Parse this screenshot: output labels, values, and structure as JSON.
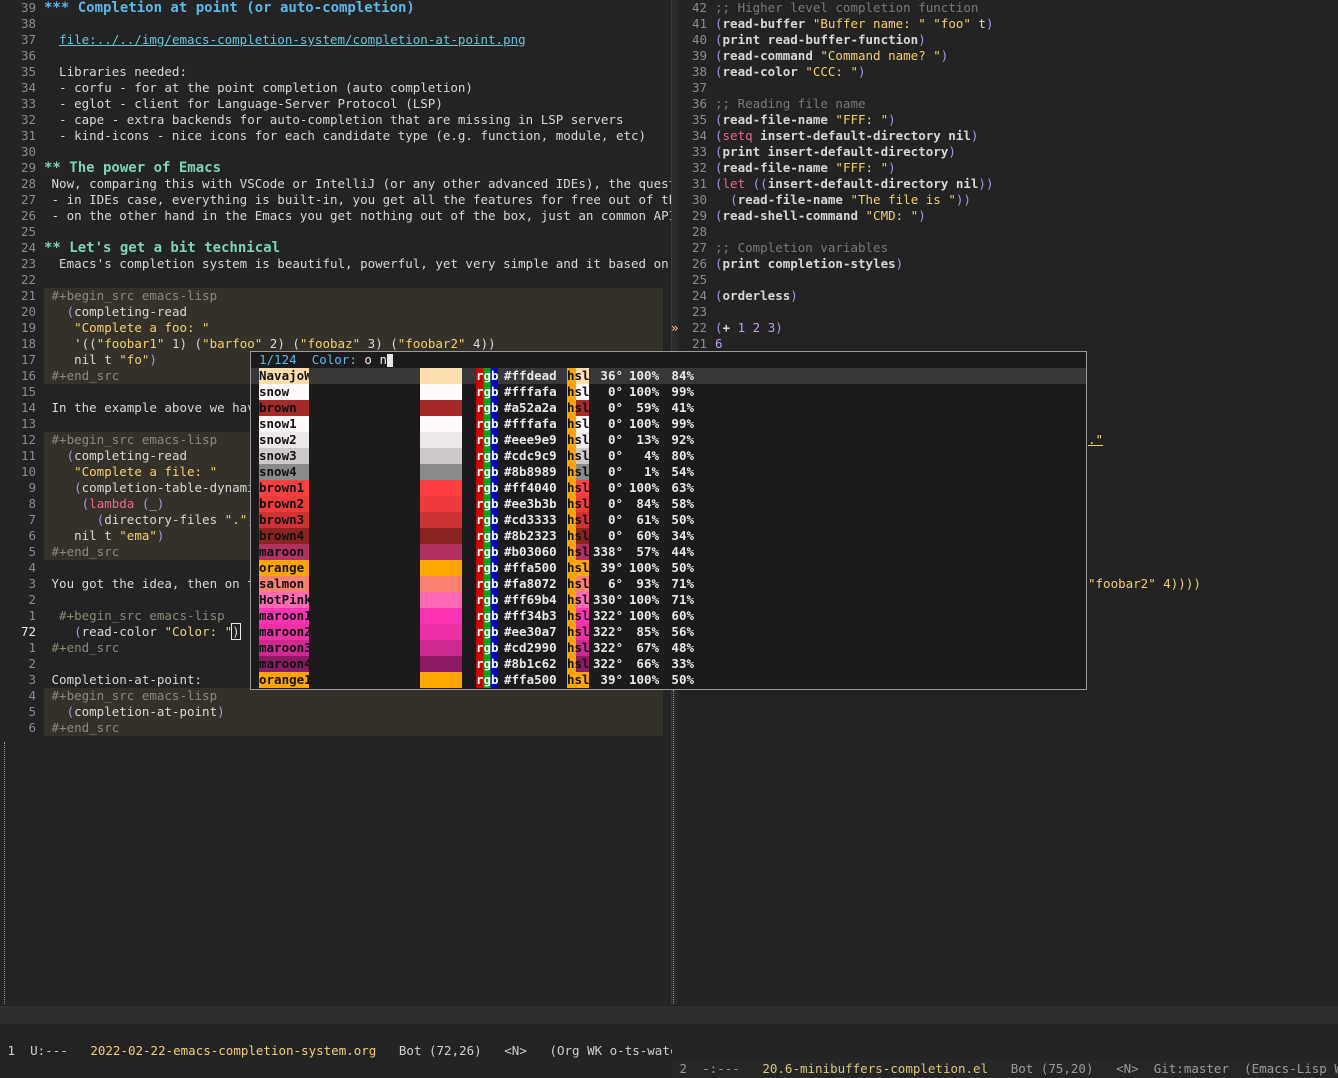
{
  "left_lines": [
    {
      "n": "39",
      "t": "heading3",
      "parts": [
        {
          "c": "heading3",
          "t": "*** Completion at point (or auto-completion)"
        }
      ]
    },
    {
      "n": "38",
      "parts": []
    },
    {
      "n": "37",
      "parts": [
        {
          "c": "",
          "t": "  "
        },
        {
          "c": "link",
          "t": "file:../../img/emacs-completion-system/completion-at-point.png"
        }
      ]
    },
    {
      "n": "36",
      "parts": []
    },
    {
      "n": "35",
      "parts": [
        {
          "c": "",
          "t": "  Libraries needed:"
        }
      ]
    },
    {
      "n": "34",
      "parts": [
        {
          "c": "",
          "t": "  - corfu - for at the point completion (auto completion)"
        }
      ]
    },
    {
      "n": "33",
      "parts": [
        {
          "c": "",
          "t": "  - eglot - client for Language-Server Protocol (LSP)"
        }
      ]
    },
    {
      "n": "32",
      "parts": [
        {
          "c": "",
          "t": "  - cape - extra backends for auto-completion that are missing in LSP servers"
        }
      ]
    },
    {
      "n": "31",
      "parts": [
        {
          "c": "",
          "t": "  - kind-icons - nice icons for each candidate type (e.g. function, module, etc)"
        }
      ]
    },
    {
      "n": "30",
      "parts": []
    },
    {
      "n": "29",
      "parts": [
        {
          "c": "heading2",
          "t": "** The power of Emacs"
        }
      ]
    },
    {
      "n": "28",
      "parts": [
        {
          "c": "",
          "t": " Now, comparing this with VSCode or IntelliJ (or any other advanced IDEs), the question »"
        }
      ]
    },
    {
      "n": "27",
      "parts": [
        {
          "c": "",
          "t": " - in IDEs case, everything is built-in, you get all the features for free out of the b»"
        }
      ]
    },
    {
      "n": "26",
      "parts": [
        {
          "c": "",
          "t": " - on the other hand in the Emacs you get nothing out of the box, just an common API an»"
        }
      ]
    },
    {
      "n": "25",
      "parts": []
    },
    {
      "n": "24",
      "parts": [
        {
          "c": "heading2",
          "t": "** Let's get a bit technical"
        }
      ]
    },
    {
      "n": "23",
      "parts": [
        {
          "c": "",
          "t": "  Emacs's completion system is beautiful, powerful, yet very simple and it based on /*c»"
        }
      ]
    },
    {
      "n": "22",
      "parts": []
    },
    {
      "n": "21",
      "src": true,
      "parts": [
        {
          "c": "meta",
          "t": " #+begin_src emacs-lisp"
        }
      ]
    },
    {
      "n": "20",
      "src": true,
      "parts": [
        {
          "c": "",
          "t": "   "
        },
        {
          "c": "paren",
          "t": "("
        },
        {
          "c": "",
          "t": "completing-read"
        }
      ]
    },
    {
      "n": "19",
      "src": true,
      "parts": [
        {
          "c": "",
          "t": "    "
        },
        {
          "c": "str",
          "t": "\"Complete a foo: \""
        }
      ]
    },
    {
      "n": "18",
      "src": true,
      "parts": [
        {
          "c": "",
          "t": "    '(("
        },
        {
          "c": "str",
          "t": "\"foobar1\""
        },
        {
          "c": "",
          "t": " 1) ("
        },
        {
          "c": "str",
          "t": "\"barfoo\""
        },
        {
          "c": "",
          "t": " 2) ("
        },
        {
          "c": "str",
          "t": "\"foobaz\""
        },
        {
          "c": "",
          "t": " 3) ("
        },
        {
          "c": "str",
          "t": "\"foobar2\""
        },
        {
          "c": "",
          "t": " 4))"
        }
      ]
    },
    {
      "n": "17",
      "src": true,
      "parts": [
        {
          "c": "",
          "t": "    nil t "
        },
        {
          "c": "str",
          "t": "\"fo\""
        },
        {
          "c": "paren",
          "t": ")"
        }
      ]
    },
    {
      "n": "16",
      "src": true,
      "parts": [
        {
          "c": "meta",
          "t": " #+end_src"
        }
      ]
    },
    {
      "n": "15",
      "parts": []
    },
    {
      "n": "14",
      "parts": [
        {
          "c": "",
          "t": " In the example above we have"
        }
      ]
    },
    {
      "n": "13",
      "parts": []
    },
    {
      "n": "12",
      "src": true,
      "parts": [
        {
          "c": "meta",
          "t": " #+begin_src emacs-lisp"
        }
      ]
    },
    {
      "n": "11",
      "src": true,
      "parts": [
        {
          "c": "",
          "t": "   "
        },
        {
          "c": "paren",
          "t": "("
        },
        {
          "c": "",
          "t": "completing-read"
        }
      ]
    },
    {
      "n": "10",
      "src": true,
      "parts": [
        {
          "c": "",
          "t": "    "
        },
        {
          "c": "str",
          "t": "\"Complete a file: \""
        }
      ]
    },
    {
      "n": "9",
      "src": true,
      "parts": [
        {
          "c": "",
          "t": "    "
        },
        {
          "c": "paren",
          "t": "("
        },
        {
          "c": "",
          "t": "completion-table-dynamic"
        }
      ]
    },
    {
      "n": "8",
      "src": true,
      "parts": [
        {
          "c": "",
          "t": "     "
        },
        {
          "c": "paren",
          "t": "("
        },
        {
          "c": "kw",
          "t": "lambda"
        },
        {
          "c": "",
          "t": " "
        },
        {
          "c": "paren",
          "t": "("
        },
        {
          "c": "",
          "t": "_"
        },
        {
          "c": "paren",
          "t": ")"
        }
      ]
    },
    {
      "n": "7",
      "src": true,
      "parts": [
        {
          "c": "",
          "t": "       "
        },
        {
          "c": "paren",
          "t": "("
        },
        {
          "c": "",
          "t": "directory-files "
        },
        {
          "c": "str",
          "t": "\".\""
        },
        {
          "c": "paren",
          "t": "))"
        }
      ]
    },
    {
      "n": "6",
      "src": true,
      "parts": [
        {
          "c": "",
          "t": "    nil t "
        },
        {
          "c": "str",
          "t": "\"ema\""
        },
        {
          "c": "paren",
          "t": ")"
        }
      ]
    },
    {
      "n": "5",
      "src": true,
      "parts": [
        {
          "c": "meta",
          "t": " #+end_src"
        }
      ]
    },
    {
      "n": "4",
      "parts": []
    },
    {
      "n": "3",
      "parts": [
        {
          "c": "",
          "t": " You got the idea, then on top"
        }
      ]
    },
    {
      "n": "2",
      "parts": []
    },
    {
      "n": "1",
      "parts": [
        {
          "c": "meta",
          "t": "  #+begin_src emacs-lisp"
        }
      ]
    },
    {
      "n": "72",
      "cur": true,
      "parts": [
        {
          "c": "",
          "t": "    "
        },
        {
          "c": "paren",
          "t": "("
        },
        {
          "c": "",
          "t": "read-color "
        },
        {
          "c": "str",
          "t": "\"Color: \""
        },
        {
          "c": "cursor",
          "t": ")"
        }
      ]
    },
    {
      "n": "1",
      "parts": [
        {
          "c": "meta",
          "t": " #+end_src"
        }
      ]
    },
    {
      "n": "2",
      "parts": []
    },
    {
      "n": "3",
      "parts": [
        {
          "c": "",
          "t": " Completion-at-point:"
        }
      ]
    },
    {
      "n": "4",
      "src": true,
      "parts": [
        {
          "c": "meta",
          "t": " #+begin_src emacs-lisp"
        }
      ]
    },
    {
      "n": "5",
      "src": true,
      "parts": [
        {
          "c": "",
          "t": "   "
        },
        {
          "c": "paren",
          "t": "("
        },
        {
          "c": "",
          "t": "completion-at-point"
        },
        {
          "c": "paren",
          "t": ")"
        }
      ]
    },
    {
      "n": "6",
      "src": true,
      "parts": [
        {
          "c": "meta",
          "t": " #+end_src"
        }
      ]
    }
  ],
  "right_lines": [
    {
      "n": "42",
      "parts": [
        {
          "c": "comment",
          "t": ";; Higher level completion function"
        }
      ]
    },
    {
      "n": "41",
      "parts": [
        {
          "c": "paren",
          "t": "("
        },
        {
          "c": "bold",
          "t": "read-buffer "
        },
        {
          "c": "str",
          "t": "\"Buffer name: \""
        },
        {
          "c": "",
          "t": " "
        },
        {
          "c": "str",
          "t": "\"foo\""
        },
        {
          "c": "",
          "t": " t"
        },
        {
          "c": "paren",
          "t": ")"
        }
      ]
    },
    {
      "n": "40",
      "parts": [
        {
          "c": "paren",
          "t": "("
        },
        {
          "c": "bold",
          "t": "print read-buffer-function"
        },
        {
          "c": "paren",
          "t": ")"
        }
      ]
    },
    {
      "n": "39",
      "parts": [
        {
          "c": "paren",
          "t": "("
        },
        {
          "c": "bold",
          "t": "read-command "
        },
        {
          "c": "str",
          "t": "\"Command name? \""
        },
        {
          "c": "paren",
          "t": ")"
        }
      ]
    },
    {
      "n": "38",
      "parts": [
        {
          "c": "paren",
          "t": "("
        },
        {
          "c": "bold",
          "t": "read-color "
        },
        {
          "c": "str",
          "t": "\"CCC: \""
        },
        {
          "c": "paren",
          "t": ")"
        }
      ]
    },
    {
      "n": "37",
      "parts": []
    },
    {
      "n": "36",
      "parts": [
        {
          "c": "comment",
          "t": ";; Reading file name"
        }
      ]
    },
    {
      "n": "35",
      "parts": [
        {
          "c": "paren",
          "t": "("
        },
        {
          "c": "bold",
          "t": "read-file-name "
        },
        {
          "c": "str",
          "t": "\"FFF: \""
        },
        {
          "c": "paren",
          "t": ")"
        }
      ]
    },
    {
      "n": "34",
      "parts": [
        {
          "c": "paren",
          "t": "("
        },
        {
          "c": "kw",
          "t": "setq"
        },
        {
          "c": "bold",
          "t": " insert-default-directory nil"
        },
        {
          "c": "paren",
          "t": ")"
        }
      ]
    },
    {
      "n": "33",
      "parts": [
        {
          "c": "paren",
          "t": "("
        },
        {
          "c": "bold",
          "t": "print insert-default-directory"
        },
        {
          "c": "paren",
          "t": ")"
        }
      ]
    },
    {
      "n": "32",
      "parts": [
        {
          "c": "paren",
          "t": "("
        },
        {
          "c": "bold",
          "t": "read-file-name "
        },
        {
          "c": "str",
          "t": "\"FFF: \""
        },
        {
          "c": "paren",
          "t": ")"
        }
      ]
    },
    {
      "n": "31",
      "parts": [
        {
          "c": "paren",
          "t": "("
        },
        {
          "c": "kw",
          "t": "let"
        },
        {
          "c": "",
          "t": " "
        },
        {
          "c": "paren",
          "t": "(("
        },
        {
          "c": "bold",
          "t": "insert-default-directory nil"
        },
        {
          "c": "paren",
          "t": "))"
        }
      ]
    },
    {
      "n": "30",
      "parts": [
        {
          "c": "",
          "t": "  "
        },
        {
          "c": "paren",
          "t": "("
        },
        {
          "c": "bold",
          "t": "read-file-name "
        },
        {
          "c": "str",
          "t": "\"The file is \""
        },
        {
          "c": "paren",
          "t": "))"
        }
      ]
    },
    {
      "n": "29",
      "parts": [
        {
          "c": "paren",
          "t": "("
        },
        {
          "c": "bold",
          "t": "read-shell-command "
        },
        {
          "c": "str",
          "t": "\"CMD: \""
        },
        {
          "c": "paren",
          "t": ")"
        }
      ]
    },
    {
      "n": "28",
      "parts": []
    },
    {
      "n": "27",
      "parts": [
        {
          "c": "comment",
          "t": ";; Completion variables"
        }
      ]
    },
    {
      "n": "26",
      "parts": [
        {
          "c": "paren",
          "t": "("
        },
        {
          "c": "bold",
          "t": "print completion-styles"
        },
        {
          "c": "paren",
          "t": ")"
        }
      ]
    },
    {
      "n": "25",
      "parts": []
    },
    {
      "n": "24",
      "parts": [
        {
          "c": "paren",
          "t": "("
        },
        {
          "c": "bold",
          "t": "orderless"
        },
        {
          "c": "paren",
          "t": ")"
        }
      ]
    },
    {
      "n": "23",
      "parts": []
    },
    {
      "n": "22",
      "parts": [
        {
          "c": "paren",
          "t": "("
        },
        {
          "c": "bold",
          "t": "+ "
        },
        {
          "c": "num",
          "t": "1 2 3"
        },
        {
          "c": "paren",
          "t": ")"
        }
      ]
    },
    {
      "n": "21",
      "parts": [
        {
          "c": "num",
          "t": "6"
        }
      ]
    }
  ],
  "right_extra": {
    "line_a": ".\"",
    "line_b": "\"foobar2\" 4))))"
  },
  "popup": {
    "count": "1/124",
    "label": "Color:",
    "input": "o n",
    "rows": [
      {
        "name": "NavajoWhite",
        "bg": "#ffdead",
        "hex": "#ffdead",
        "h": "36°",
        "s": "100%",
        "l": "84%",
        "sel": true
      },
      {
        "name": "snow",
        "bg": "#fffafa",
        "hex": "#fffafa",
        "h": "0°",
        "s": "100%",
        "l": "99%"
      },
      {
        "name": "brown",
        "bg": "#a52a2a",
        "hex": "#a52a2a",
        "h": "0°",
        "s": "59%",
        "l": "41%"
      },
      {
        "name": "snow1",
        "bg": "#fffafa",
        "hex": "#fffafa",
        "h": "0°",
        "s": "100%",
        "l": "99%"
      },
      {
        "name": "snow2",
        "bg": "#eee9e9",
        "hex": "#eee9e9",
        "h": "0°",
        "s": "13%",
        "l": "92%"
      },
      {
        "name": "snow3",
        "bg": "#cdc9c9",
        "hex": "#cdc9c9",
        "h": "0°",
        "s": "4%",
        "l": "80%"
      },
      {
        "name": "snow4",
        "bg": "#8b8989",
        "hex": "#8b8989",
        "h": "0°",
        "s": "1%",
        "l": "54%"
      },
      {
        "name": "brown1",
        "bg": "#ff4040",
        "hex": "#ff4040",
        "h": "0°",
        "s": "100%",
        "l": "63%"
      },
      {
        "name": "brown2",
        "bg": "#ee3b3b",
        "hex": "#ee3b3b",
        "h": "0°",
        "s": "84%",
        "l": "58%"
      },
      {
        "name": "brown3",
        "bg": "#cd3333",
        "hex": "#cd3333",
        "h": "0°",
        "s": "61%",
        "l": "50%"
      },
      {
        "name": "brown4",
        "bg": "#8b2323",
        "hex": "#8b2323",
        "h": "0°",
        "s": "60%",
        "l": "34%"
      },
      {
        "name": "maroon",
        "bg": "#b03060",
        "hex": "#b03060",
        "h": "338°",
        "s": "57%",
        "l": "44%"
      },
      {
        "name": "orange",
        "bg": "#ffa500",
        "hex": "#ffa500",
        "h": "39°",
        "s": "100%",
        "l": "50%"
      },
      {
        "name": "salmon",
        "bg": "#fa8072",
        "hex": "#fa8072",
        "h": "6°",
        "s": "93%",
        "l": "71%"
      },
      {
        "name": "HotPink",
        "bg": "#ff69b4",
        "hex": "#ff69b4",
        "h": "330°",
        "s": "100%",
        "l": "71%"
      },
      {
        "name": "maroon1",
        "bg": "#ff34b3",
        "hex": "#ff34b3",
        "h": "322°",
        "s": "100%",
        "l": "60%"
      },
      {
        "name": "maroon2",
        "bg": "#ee30a7",
        "hex": "#ee30a7",
        "h": "322°",
        "s": "85%",
        "l": "56%"
      },
      {
        "name": "maroon3",
        "bg": "#cd2990",
        "hex": "#cd2990",
        "h": "322°",
        "s": "67%",
        "l": "48%"
      },
      {
        "name": "maroon4",
        "bg": "#8b1c62",
        "hex": "#8b1c62",
        "h": "322°",
        "s": "66%",
        "l": "33%"
      },
      {
        "name": "orange1",
        "bg": "#ffa500",
        "hex": "#ffa500",
        "h": "39°",
        "s": "100%",
        "l": "50%"
      }
    ],
    "rgb_label": "rgb",
    "hsl_label": "hsl"
  },
  "modeline": {
    "left_win": "1",
    "left_state": "U:---",
    "left_file": "2022-02-22-emacs-completion-system.org",
    "left_pos": "Bot (72,26)",
    "left_evil": "<N>",
    "left_modes": "(Org WK o-ts-watch OTS F",
    "right_win": "2",
    "right_state": "-:---",
    "right_file": "20.6-minibuffers-completion.el",
    "right_pos": "Bot (75,20)",
    "right_evil": "<N>",
    "right_vc": "Git:master",
    "right_modes": "(Emacs-Lisp WK o-ts-"
  }
}
